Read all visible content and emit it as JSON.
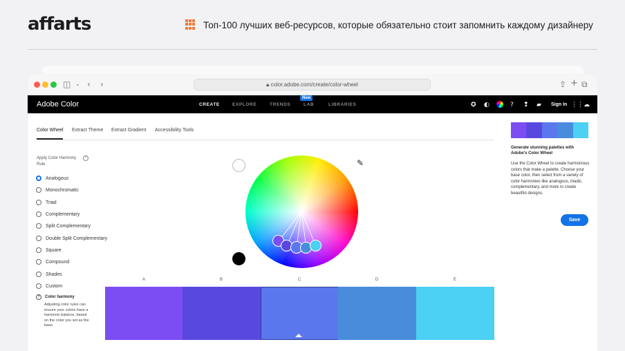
{
  "header": {
    "logo": "affarts",
    "headline": "Топ-100 лучших веб-ресурсов, которые обязательно стоит запомнить каждому дизайнеру",
    "accent_color": "#f17a3a"
  },
  "browser": {
    "url": "color.adobe.com/create/color-wheel",
    "lock_icon": "lock-icon",
    "traffic_lights": [
      "#ff5f57",
      "#febc2e",
      "#28c840"
    ]
  },
  "appbar": {
    "title": "Adobe Color",
    "nav": [
      "CREATE",
      "EXPLORE",
      "TRENDS",
      "LAB",
      "LIBRARIES"
    ],
    "new_badge": "New",
    "sign_in": "Sign In"
  },
  "tabs": [
    "Color Wheel",
    "Extract Theme",
    "Extract Gradient",
    "Accessibility Tools"
  ],
  "harmony": {
    "title": "Apply Color Harmony Rule",
    "options": [
      "Analogous",
      "Monochromatic",
      "Triad",
      "Complementary",
      "Split Complementary",
      "Double Split Complementary",
      "Square",
      "Compound",
      "Shades",
      "Custom"
    ],
    "selected": "Analogous",
    "help_title": "Color harmony",
    "help_text": "Adjusting color rules can ensure your colors have a harmonic balance, based on the color you set as the base."
  },
  "swatches": {
    "labels": [
      "A",
      "B",
      "C",
      "D",
      "E"
    ],
    "colors": [
      "#7c4df2",
      "#5948de",
      "#5b77ee",
      "#4a8cdc",
      "#4cd0f3"
    ],
    "base_index": 2
  },
  "right_panel": {
    "title": "Generate stunning palettes with Adobe's Color Wheel",
    "text": "Use the Color Wheel to create harmonious colors that make a palette. Choose your base color, then select from a variety of color harmonies like analogous, triadic, complementary, and more to create beautiful designs.",
    "save": "Save"
  }
}
